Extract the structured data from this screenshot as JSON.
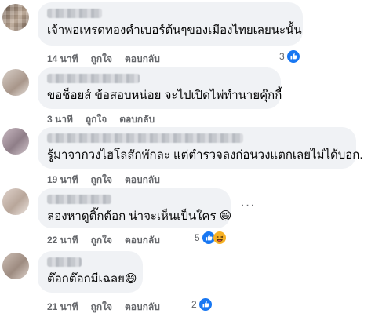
{
  "comments": [
    {
      "text": "เจ้าพ่อเทรดทองคำเบอร์ต้นๆของเมืองไทยเลยนะนั้น",
      "time": "14 นาที",
      "like_label": "ถูกใจ",
      "reply_label": "ตอบกลับ",
      "reaction_count": "3",
      "reaction_icons": [
        "like-icon"
      ]
    },
    {
      "text": "ขอช็อยส์ ข้อสอบหน่อย จะไปเปิดไพ่ทำนายคุ๊กกี้",
      "time": "3 นาที",
      "like_label": "ถูกใจ",
      "reply_label": "ตอบกลับ",
      "reaction_count": "",
      "reaction_icons": []
    },
    {
      "text": "รู้มาจากวงไฮโลสักพักละ แต่ตำรวจลงก่อนวงแตกเลยไม่ได้บอก.",
      "time": "19 นาที",
      "like_label": "ถูกใจ",
      "reply_label": "ตอบกลับ",
      "reaction_count": "",
      "reaction_icons": []
    },
    {
      "text": "ลองหาดูติ๊กต้อก น่าจะเห็นเป็นใคร 😄",
      "time": "22 นาที",
      "like_label": "ถูกใจ",
      "reply_label": "ตอบกลับ",
      "reaction_count": "5",
      "reaction_icons": [
        "like-icon",
        "laugh-icon"
      ]
    },
    {
      "text": "ต๊อกต๊อกมีเฉลย😄",
      "time": "21 นาที",
      "like_label": "ถูกใจ",
      "reply_label": "ตอบกลับ",
      "reaction_count": "2",
      "reaction_icons": [
        "like-icon"
      ]
    }
  ],
  "more_label": "···",
  "colors": {
    "bubble": "#f0f2f5",
    "meta": "#65676b",
    "like_blue": "#1877f2"
  }
}
